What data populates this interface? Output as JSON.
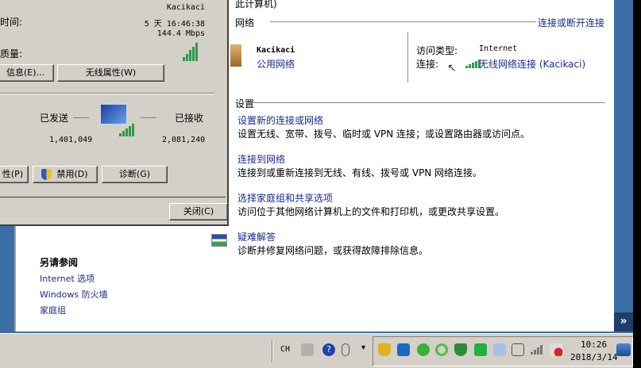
{
  "main": {
    "top_fragment": "此计算机)",
    "network_section": "网络",
    "connect_disconnect": "连接或断开连接",
    "network_name": "Kacikaci",
    "network_type": "公用网络",
    "access_type_label": "访问类型:",
    "access_type_value": "Internet",
    "connection_label": "连接:",
    "connection_value": "无线网络连接 (Kacikaci)",
    "settings_section": "设置",
    "tasks": [
      {
        "title": "设置新的连接或网络",
        "desc": "设置无线、宽带、拨号、临时或 VPN 连接；或设置路由器或访问点。"
      },
      {
        "title": "连接到网络",
        "desc": "连接到或重新连接到无线、有线、拨号或 VPN 网络连接。"
      },
      {
        "title": "选择家庭组和共享选项",
        "desc": "访问位于其他网络计算机上的文件和打印机，或更改共享设置。"
      },
      {
        "title": "疑难解答",
        "desc": "诊断并修复网络问题，或获得故障排除信息。"
      }
    ],
    "see_also": {
      "title": "另请参阅",
      "links": [
        "Internet 选项",
        "Windows 防火墙",
        "家庭组"
      ]
    }
  },
  "dialog": {
    "ssid": "Kacikaci",
    "duration_label": "时间:",
    "duration_value": "5 天 16:46:38",
    "speed_value": "144.4 Mbps",
    "quality_label": "质量:",
    "details_button": "信息(E)...",
    "wireless_props_button": "无线属性(W)",
    "sent_label": "已发送",
    "received_label": "已接收",
    "sent_value": "1,401,049",
    "received_value": "2,081,240",
    "properties_button": "性(P)",
    "disable_button": "禁用(D)",
    "diagnose_button": "诊断(G)",
    "close_button": "关闭(C)"
  },
  "taskbar": {
    "language": "CH",
    "time": "10:26",
    "date": "2018/3/14"
  },
  "colors": {
    "link": "#1a2a8c",
    "desktop": "#3a6ea5",
    "face": "#d4d0c8"
  }
}
